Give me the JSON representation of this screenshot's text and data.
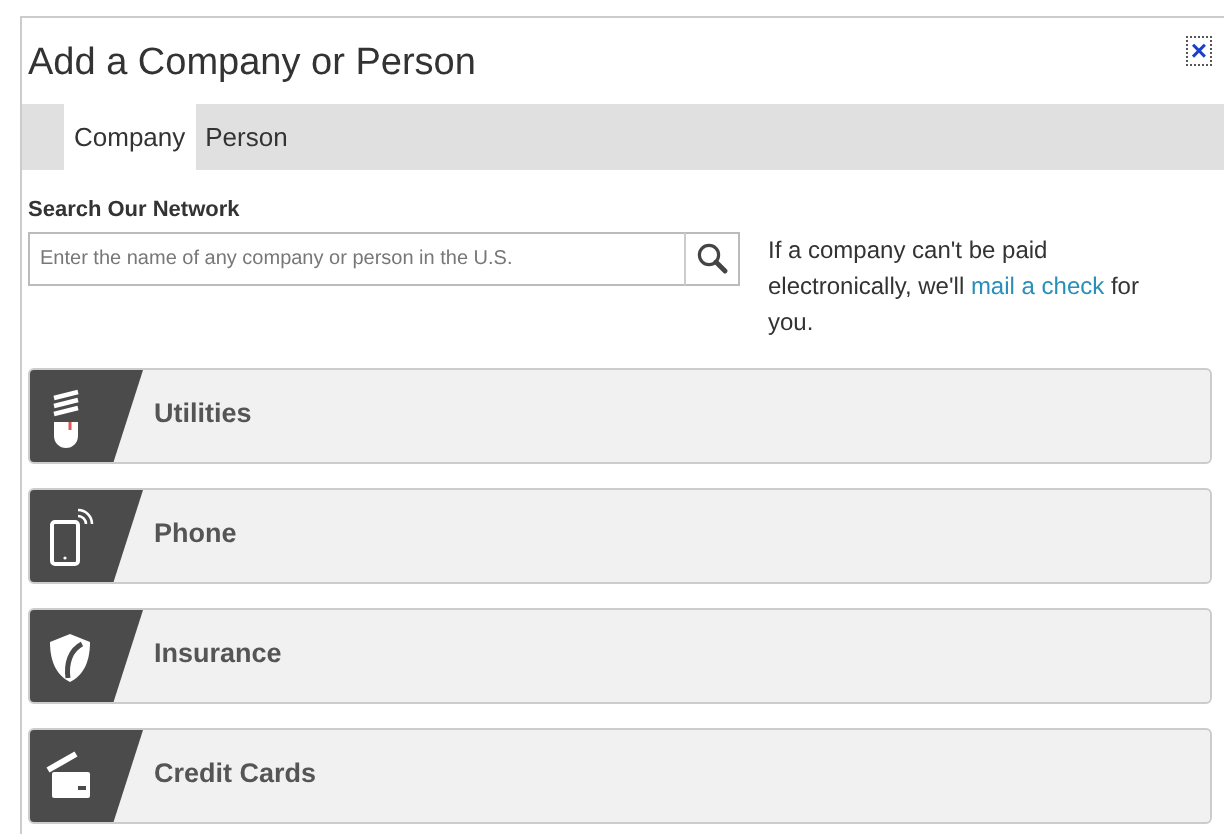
{
  "dialog": {
    "title": "Add a Company or Person",
    "close": "×"
  },
  "tabs": [
    {
      "label": "Company",
      "selected": true
    },
    {
      "label": "Person",
      "selected": false
    }
  ],
  "search": {
    "label": "Search Our Network",
    "placeholder": "Enter the name of any company or person in the U.S."
  },
  "note": {
    "before": "If a company can't be paid electronically, we'll ",
    "link": "mail a check",
    "after": " for you."
  },
  "categories": [
    {
      "label": "Utilities",
      "kind": "bulb"
    },
    {
      "label": "Phone",
      "kind": "tablet"
    },
    {
      "label": "Insurance",
      "kind": "shield"
    },
    {
      "label": "Credit Cards",
      "kind": "card"
    }
  ]
}
